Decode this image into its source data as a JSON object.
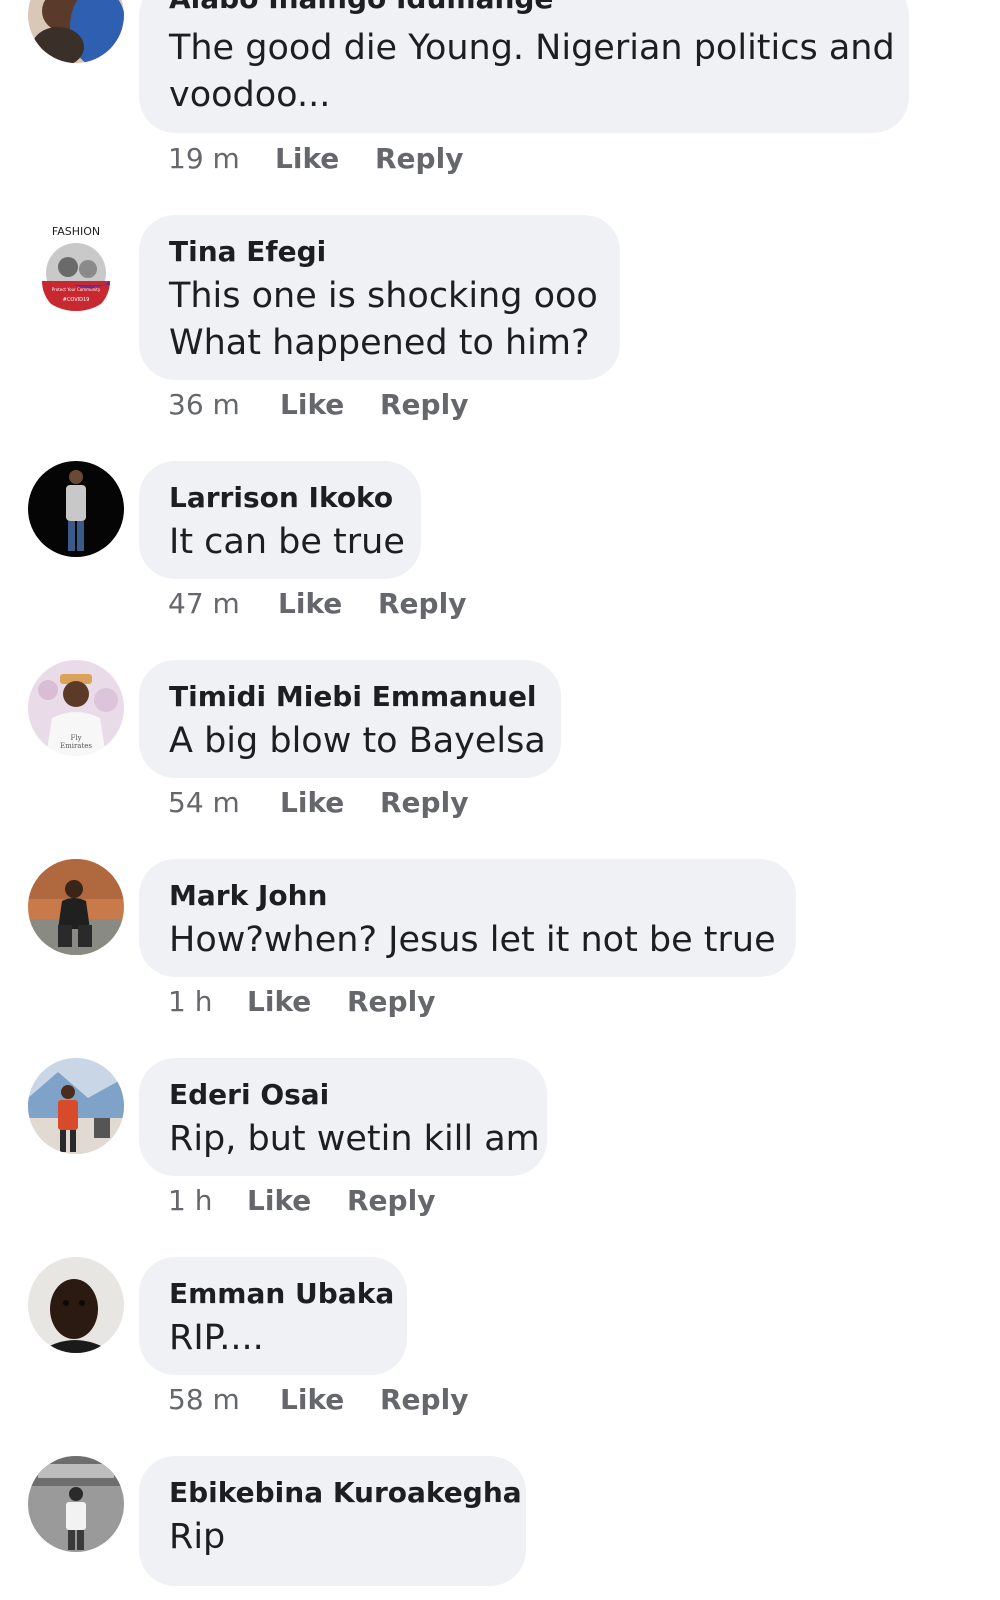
{
  "comments": [
    {
      "author": "Alabo Inaingo Idumange",
      "text_line1": "The good die Young. Nigerian politics and",
      "text_line2": "voodoo...",
      "time": "19 m",
      "like_label": "Like",
      "reply_label": "Reply"
    },
    {
      "author": "Tina Efegi",
      "text_line1": "This one is shocking ooo",
      "text_line2": "What happened to him?",
      "time": "36 m",
      "like_label": "Like",
      "reply_label": "Reply",
      "avatar_caption": "FASHION",
      "avatar_badge_line1": "Protect Your Community",
      "avatar_badge_line2": "#COVID19"
    },
    {
      "author": "Larrison Ikoko",
      "text_line1": "It can be true",
      "time": "47 m",
      "like_label": "Like",
      "reply_label": "Reply"
    },
    {
      "author": "Timidi Miebi Emmanuel",
      "text_line1": "A big blow to Bayelsa",
      "time": "54 m",
      "like_label": "Like",
      "reply_label": "Reply",
      "avatar_shirt_text_line1": "Fly",
      "avatar_shirt_text_line2": "Emirates"
    },
    {
      "author": "Mark John",
      "text_line1": "How?when? Jesus let it not be true",
      "time": "1 h",
      "like_label": "Like",
      "reply_label": "Reply"
    },
    {
      "author": "Ederi Osai",
      "text_line1": "Rip, but wetin kill am",
      "time": "1 h",
      "like_label": "Like",
      "reply_label": "Reply"
    },
    {
      "author": "Emman Ubaka",
      "text_line1": "RIP....",
      "time": "58 m",
      "like_label": "Like",
      "reply_label": "Reply"
    },
    {
      "author": "Ebikebina Kuroakegha",
      "text_line1": "Rip"
    }
  ],
  "colors": {
    "bubble": "#eff1f4",
    "text": "#1c1e21",
    "meta": "#65676b"
  }
}
